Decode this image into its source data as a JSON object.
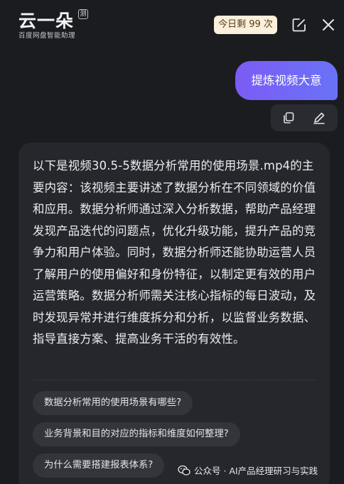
{
  "header": {
    "logo_title": "云一朵",
    "logo_badge": "测",
    "logo_subtitle": "百度网盘智能助理",
    "quota": "今日剩 99 次",
    "icons": [
      "edit-icon",
      "close-icon"
    ]
  },
  "conversation": {
    "user_message": "提炼视频大意",
    "answer": "以下是视频30.5-5数据分析常用的使用场景.mp4的主要内容：该视频主要讲述了数据分析在不同领域的价值和应用。数据分析师通过深入分析数据，帮助产品经理发现产品迭代的问题点，优化升级功能，提升产品的竞争力和用户体验。同时，数据分析师还能协助运营人员了解用户的使用偏好和身份特征，以制定更有效的用户运营策略。数据分析师需关注核心指标的每日波动，及时发现异常并进行维度拆分和分析，以监督业务数据、指导直接方案、提高业务干活的有效性。",
    "suggestions": [
      "数据分析常用的使用场景有哪些?",
      "业务背景和目的对应的指标和维度如何整理?",
      "为什么需要搭建报表体系?"
    ]
  },
  "footer": {
    "watermark": "公众号 · AI产品经理研习与实践"
  },
  "colors": {
    "background": "#1b1c20",
    "card": "#26272d",
    "user_bubble_start": "#7b5cf5",
    "user_bubble_end": "#6a72f7",
    "quota_bg": "#fbf0dc"
  }
}
